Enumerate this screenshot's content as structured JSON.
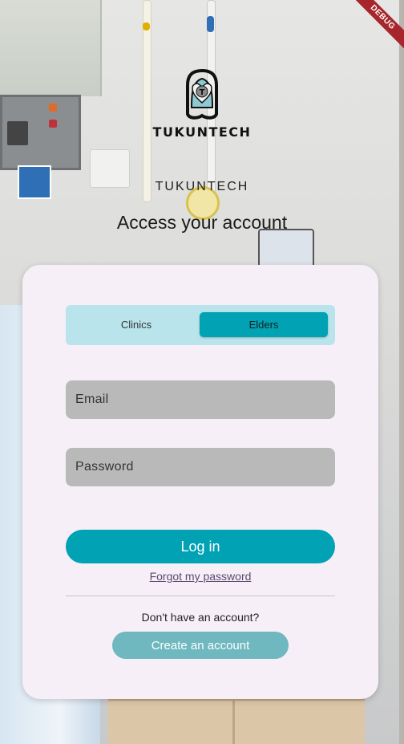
{
  "debug_banner": "DEBUG",
  "brand": {
    "logo_letter": "T",
    "logo_text": "TUKUNTECH",
    "title": "TUKUNTECH",
    "headline": "Access your account"
  },
  "role_toggle": {
    "options": [
      "Clinics",
      "Elders"
    ],
    "selected": "Elders"
  },
  "form": {
    "email_placeholder": "Email",
    "password_placeholder": "Password",
    "login_label": "Log in",
    "forgot_label": "Forgot my password",
    "no_account_text": "Don't have an account?",
    "create_label": "Create an account"
  },
  "colors": {
    "accent": "#00a2b3",
    "toggle_bg": "#b9e4eb",
    "card_bg": "#f7eff8",
    "field_bg": "#b9b9b9",
    "secondary_button": "#6fb8bf",
    "debug_ribbon": "#a6262c"
  },
  "icons": {
    "logo": "stethoscope-heart-icon"
  }
}
